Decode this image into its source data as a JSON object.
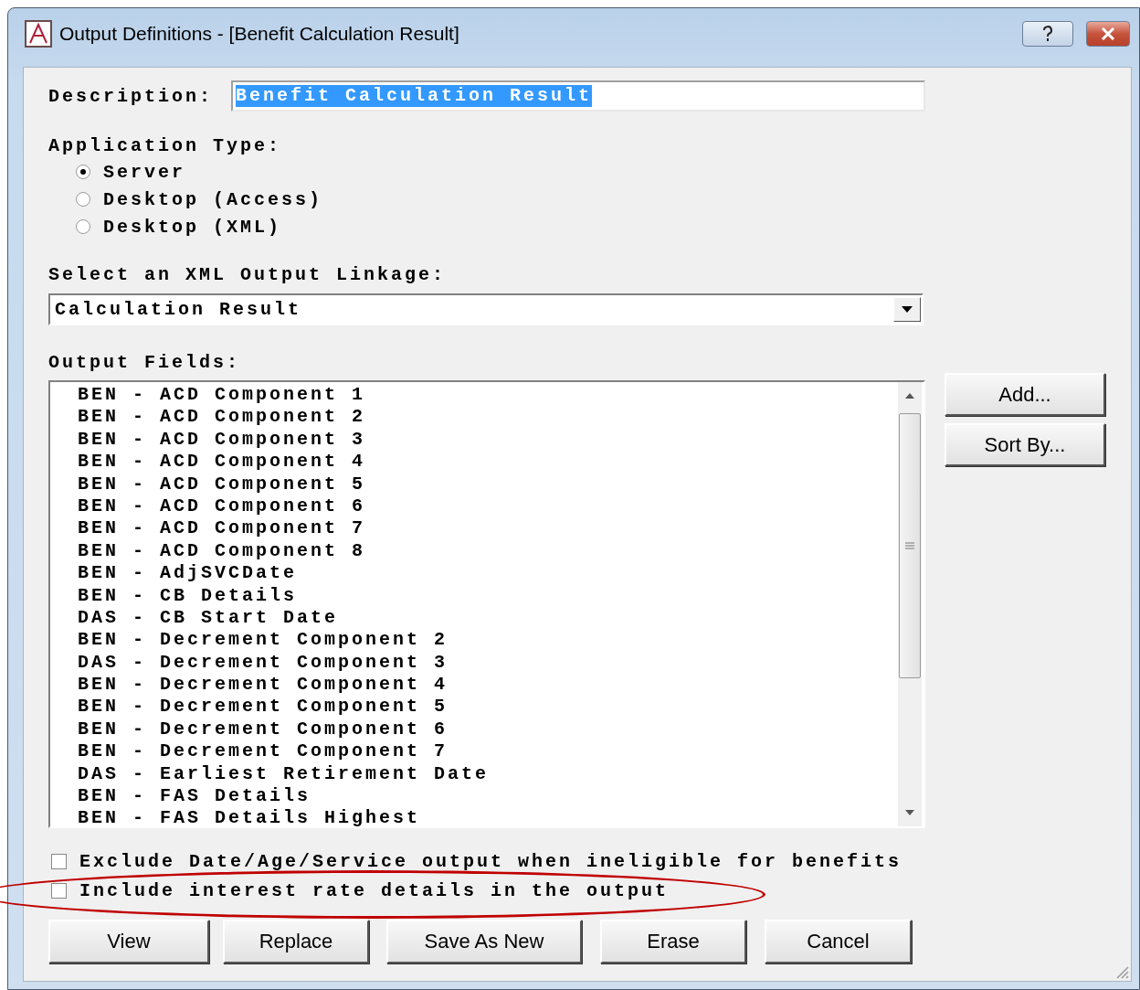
{
  "window": {
    "title": "Output Definitions - [Benefit Calculation Result]"
  },
  "description": {
    "label": "Description:",
    "value": "Benefit Calculation Result",
    "selected": true
  },
  "application_type": {
    "label": "Application Type:",
    "options": [
      {
        "label": "Server",
        "selected": true
      },
      {
        "label": "Desktop (Access)",
        "selected": false
      },
      {
        "label": "Desktop (XML)",
        "selected": false
      }
    ]
  },
  "linkage": {
    "label": "Select an XML Output Linkage:",
    "value": "Calculation Result"
  },
  "output_fields": {
    "label": "Output Fields:",
    "items": [
      "BEN - ACD Component 1",
      "BEN - ACD Component 2",
      "BEN - ACD Component 3",
      "BEN - ACD Component 4",
      "BEN - ACD Component 5",
      "BEN - ACD Component 6",
      "BEN - ACD Component 7",
      "BEN - ACD Component 8",
      "BEN - AdjSVCDate",
      "BEN - CB Details",
      "DAS - CB Start Date",
      "BEN - Decrement Component 2",
      "DAS - Decrement Component 3",
      "BEN - Decrement Component 4",
      "BEN - Decrement Component 5",
      "BEN - Decrement Component 6",
      "BEN - Decrement Component 7",
      "DAS - Earliest Retirement Date",
      "BEN - FAS Details",
      "BEN - FAS Details Highest"
    ]
  },
  "side_buttons": [
    "Add...",
    "Sort By..."
  ],
  "options": [
    {
      "label": "Exclude Date/Age/Service output when ineligible for benefits",
      "checked": false
    },
    {
      "label": "Include interest rate details in the output",
      "checked": false
    }
  ],
  "buttons": [
    "View",
    "Replace",
    "Save As New",
    "Erase",
    "Cancel"
  ]
}
